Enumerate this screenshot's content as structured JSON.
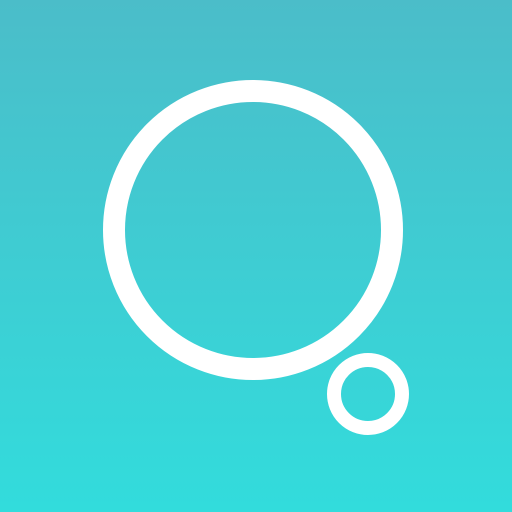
{
  "icon": {
    "name": "thought-bubble-logo",
    "gradient_top_color": "#4bbdc9",
    "gradient_bottom_color": "#32dcdc",
    "mark_color": "#ffffff"
  }
}
